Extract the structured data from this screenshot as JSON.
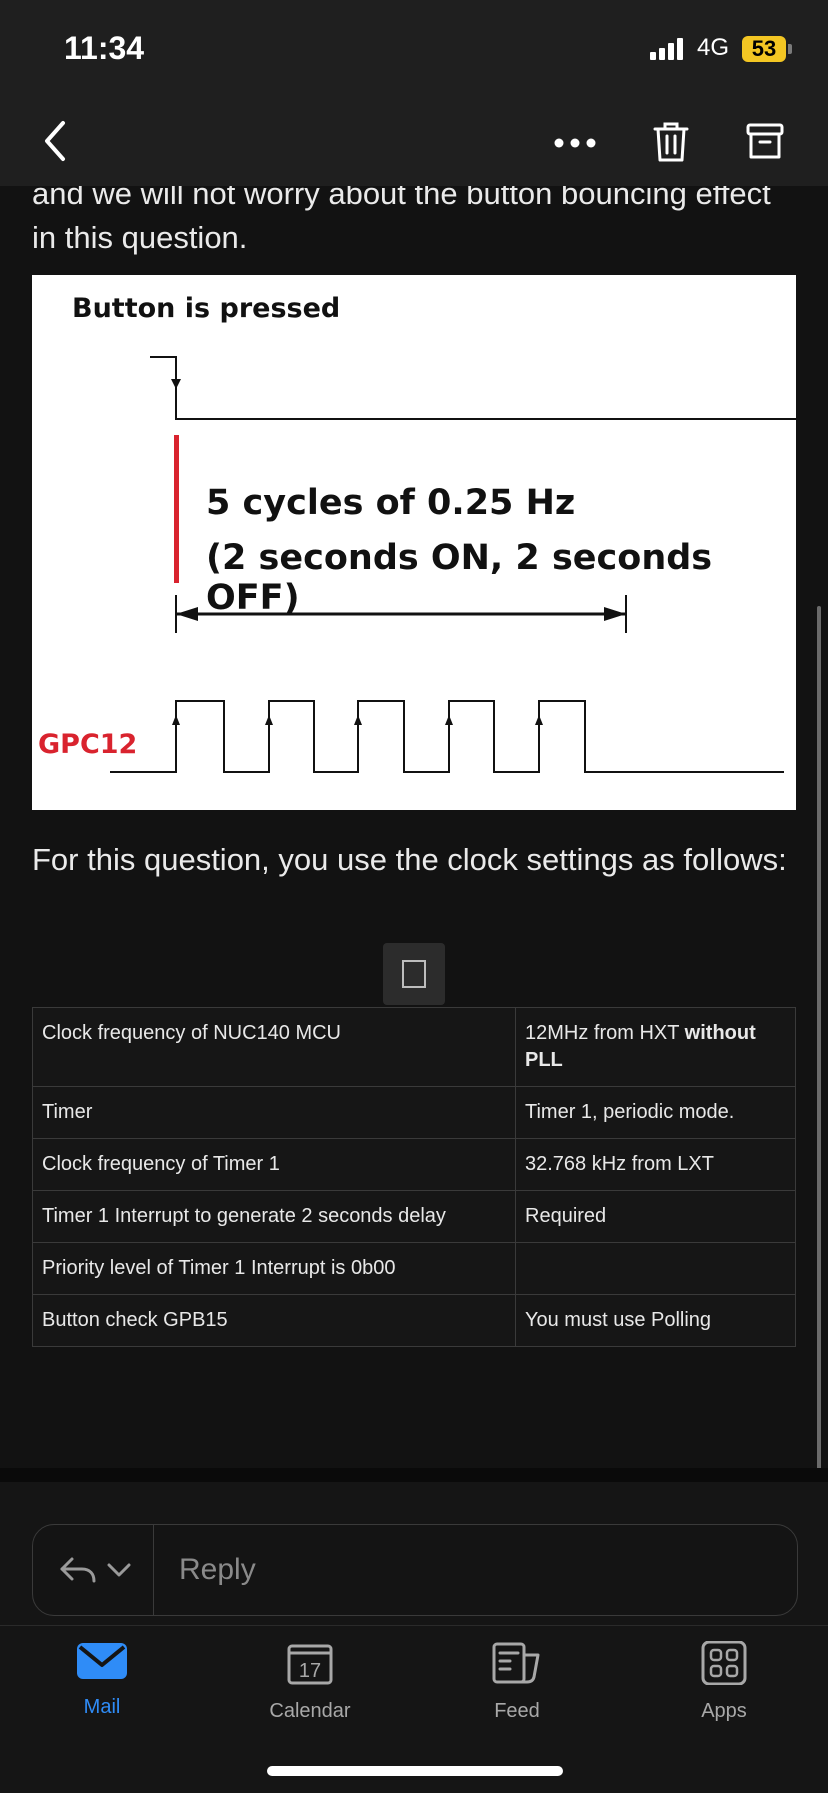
{
  "status_bar": {
    "time": "11:34",
    "network": "4G",
    "battery": "53"
  },
  "email": {
    "paragraph_top": "and we will not worry about the button bouncing effect in this question.",
    "figure": {
      "title": "Button is pressed",
      "cycles_line1": "5 cycles of 0.25 Hz",
      "cycles_line2": "(2 seconds ON, 2 seconds OFF)",
      "signal_label": "GPC12"
    },
    "paragraph_clock": "For this question, you use the clock settings as follows:",
    "table": {
      "rows": [
        {
          "param": "Clock frequency of NUC140 MCU",
          "value": "12MHz from HXT",
          "value_bold": "without PLL"
        },
        {
          "param": "Timer",
          "value": "Timer 1, periodic mode.",
          "value_bold": ""
        },
        {
          "param": "Clock frequency of Timer 1",
          "value": "32.768 kHz from LXT",
          "value_bold": ""
        },
        {
          "param": "Timer 1 Interrupt to generate 2 seconds delay",
          "value": "Required",
          "value_bold": ""
        },
        {
          "param": "Priority level of Timer 1 Interrupt is 0b00",
          "value": "",
          "value_bold": ""
        },
        {
          "param": "Button check GPB15",
          "value": "You must use Polling",
          "value_bold": ""
        }
      ]
    }
  },
  "reply": {
    "placeholder": "Reply"
  },
  "tabs": [
    {
      "label": "Mail",
      "active": true
    },
    {
      "label": "Calendar",
      "date": "17"
    },
    {
      "label": "Feed"
    },
    {
      "label": "Apps"
    }
  ],
  "colors": {
    "accent": "#2f8cf7",
    "battery": "#f3c623",
    "signal_red": "#d9232e"
  }
}
